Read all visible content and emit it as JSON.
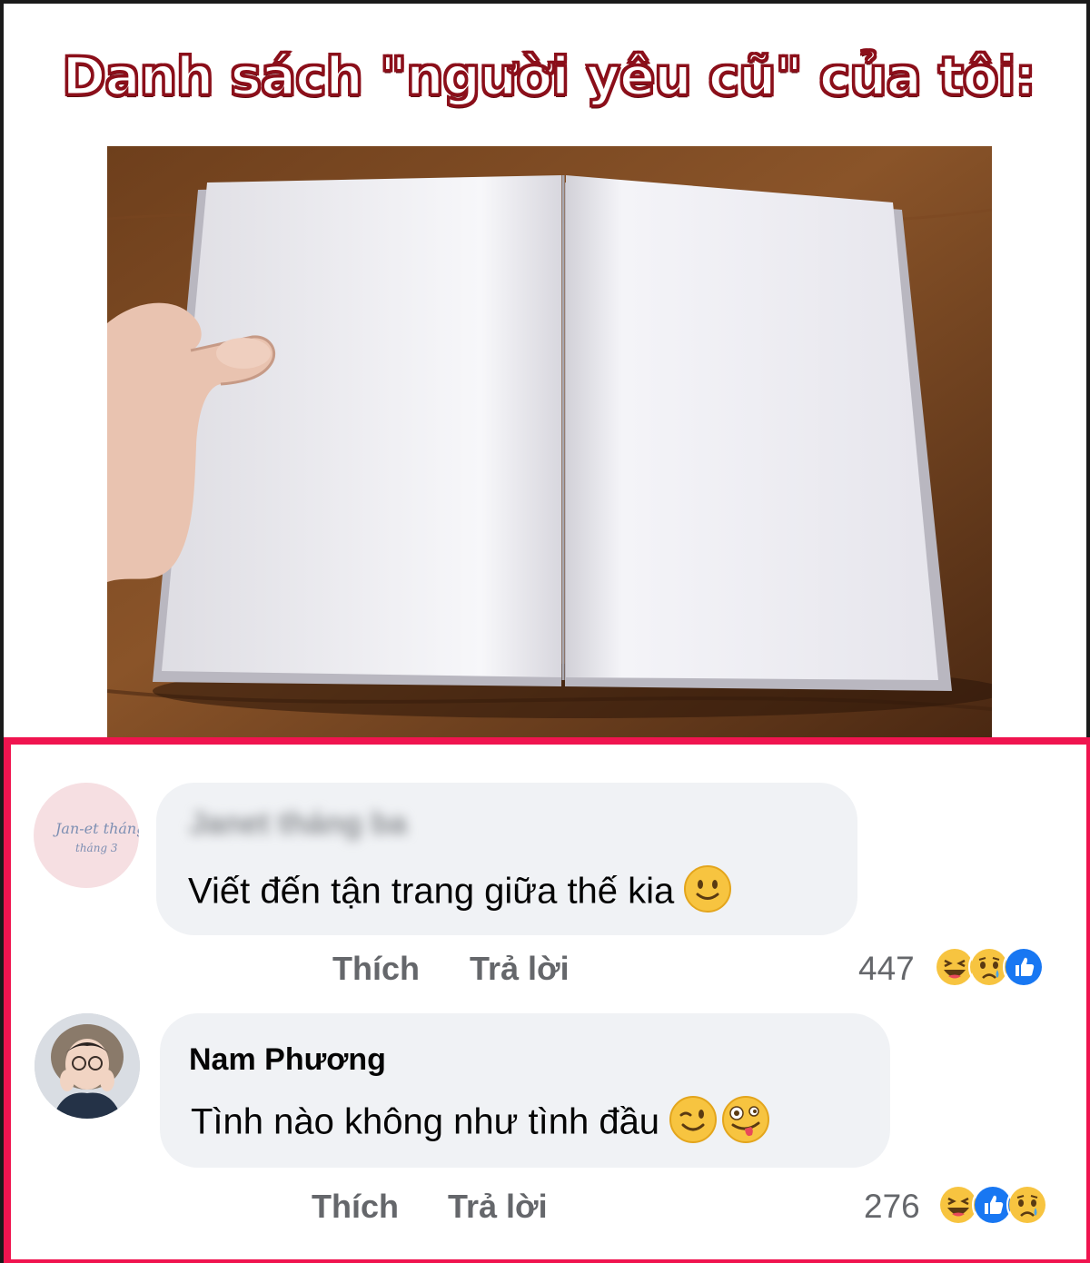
{
  "title": "Danh sách \"người yêu cũ\" của tôi:",
  "photo": {
    "subject": "open-blank-notebook"
  },
  "colors": {
    "title_outline": "#8b0f1a",
    "comments_border": "#f0144f",
    "bubble_bg": "#f0f2f5",
    "action_text": "#65676b"
  },
  "comments": [
    {
      "author": "Janet tháng ba",
      "author_blurred": true,
      "avatar_text": "Jan-et tháng 3",
      "text": "Viết đến tận trang giữa thế kia",
      "emojis": [
        "slightly-smiling-face-icon"
      ],
      "like_label": "Thích",
      "reply_label": "Trả lời",
      "reaction_count": "447",
      "reactions": [
        "haha-reaction-icon",
        "sad-reaction-icon",
        "like-reaction-icon"
      ]
    },
    {
      "author": "Nam Phương",
      "author_blurred": false,
      "text": "Tình nào không như tình đầu",
      "emojis": [
        "winking-face-icon",
        "zany-face-icon"
      ],
      "like_label": "Thích",
      "reply_label": "Trả lời",
      "reaction_count": "276",
      "reactions": [
        "haha-reaction-icon",
        "like-reaction-icon",
        "sad-reaction-icon"
      ]
    }
  ]
}
